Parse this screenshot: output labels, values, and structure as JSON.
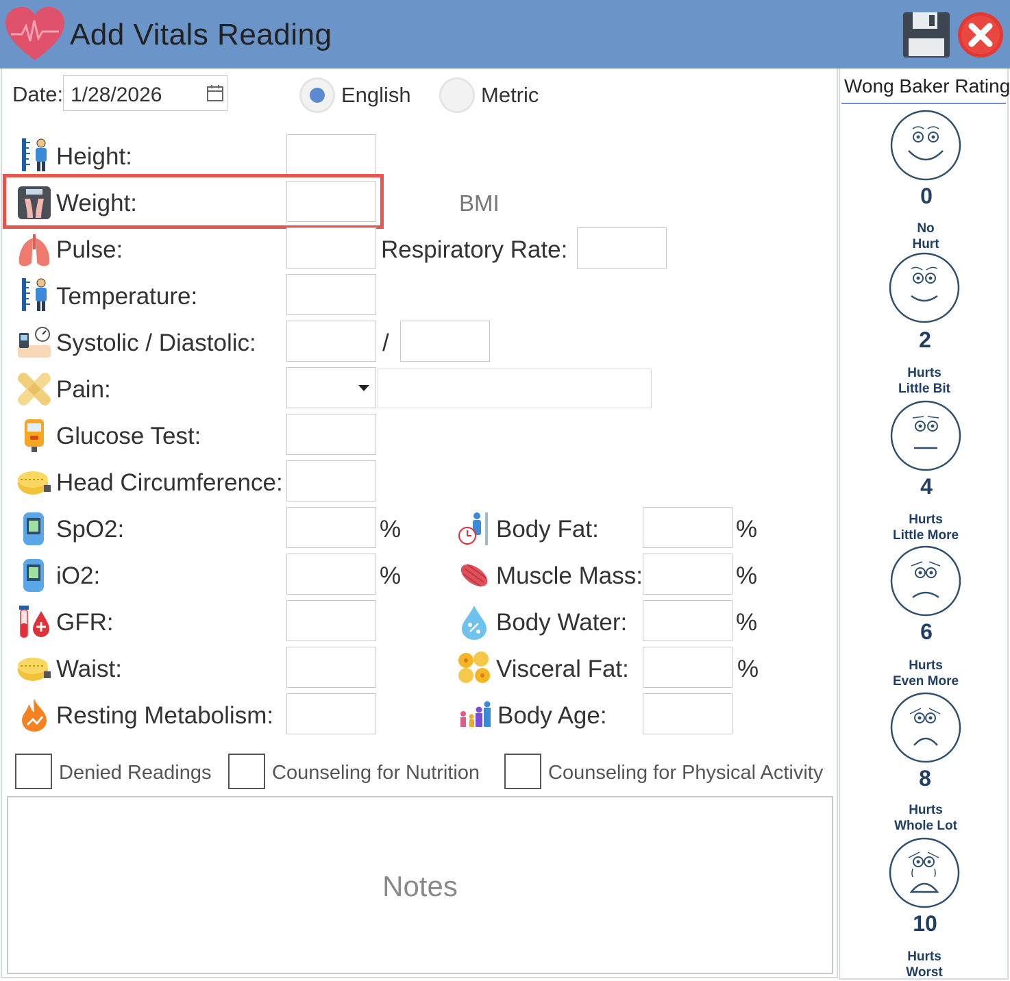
{
  "window": {
    "title": "Add Vitals Reading",
    "accent_color": "#6b94c8",
    "save_icon": "floppy-disk-icon",
    "close_icon": "close-icon"
  },
  "date": {
    "label": "Date:",
    "value": "1/28/2026"
  },
  "units": {
    "english": "English",
    "metric": "Metric",
    "selected": "English"
  },
  "fields": {
    "height": "Height:",
    "weight": "Weight:",
    "bmi": "BMI",
    "pulse": "Pulse:",
    "respiratory_rate": "Respiratory Rate:",
    "temperature": "Temperature:",
    "bp": "Systolic / Diastolic:",
    "bp_sep": "/",
    "pain": "Pain:",
    "glucose": "Glucose Test:",
    "head": "Head Circumference:",
    "spo2": "SpO2:",
    "io2": "iO2:",
    "gfr": "GFR:",
    "waist": "Waist:",
    "resting": "Resting Metabolism:",
    "body_fat": "Body Fat:",
    "muscle": "Muscle Mass:",
    "water": "Body Water:",
    "visceral": "Visceral Fat:",
    "body_age": "Body Age:",
    "percent": "%"
  },
  "checkboxes": {
    "denied": "Denied Readings",
    "nutrition": "Counseling for Nutrition",
    "physical": "Counseling for Physical Activity"
  },
  "notes": {
    "placeholder": "Notes"
  },
  "wong_baker": {
    "title": "Wong Baker Rating",
    "faces": [
      {
        "value": "0",
        "line1": "No",
        "line2": "Hurt"
      },
      {
        "value": "2",
        "line1": "Hurts",
        "line2": "Little Bit"
      },
      {
        "value": "4",
        "line1": "Hurts",
        "line2": "Little More"
      },
      {
        "value": "6",
        "line1": "Hurts",
        "line2": "Even More"
      },
      {
        "value": "8",
        "line1": "Hurts",
        "line2": "Whole Lot"
      },
      {
        "value": "10",
        "line1": "Hurts",
        "line2": "Worst"
      }
    ]
  }
}
